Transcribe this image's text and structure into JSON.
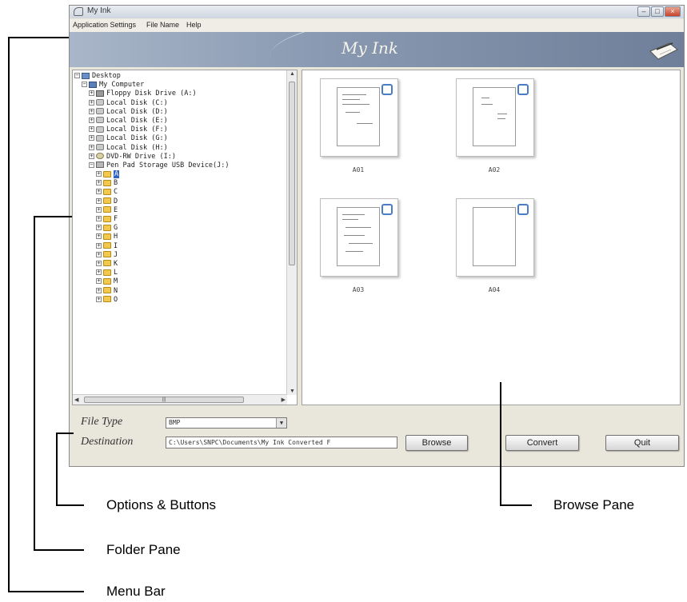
{
  "window": {
    "title": "My Ink",
    "controls": [
      "–",
      "□",
      "×"
    ]
  },
  "menu": {
    "items": [
      "Application Settings",
      "File Name",
      "Help"
    ]
  },
  "banner": {
    "title": "My Ink"
  },
  "tree": [
    {
      "label": "Desktop",
      "icon": "desktop-icon",
      "level": 0,
      "expander": "−"
    },
    {
      "label": "My Computer",
      "icon": "computer-icon",
      "level": 1,
      "expander": "−"
    },
    {
      "label": "Floppy Disk Drive (A:)",
      "icon": "floppy-icon",
      "level": 2,
      "expander": "+"
    },
    {
      "label": "Local Disk (C:)",
      "icon": "drive-icon",
      "level": 2,
      "expander": "+"
    },
    {
      "label": "Local Disk (D:)",
      "icon": "drive-icon",
      "level": 2,
      "expander": "+"
    },
    {
      "label": "Local Disk (E:)",
      "icon": "drive-icon",
      "level": 2,
      "expander": "+"
    },
    {
      "label": "Local Disk (F:)",
      "icon": "drive-icon",
      "level": 2,
      "expander": "+"
    },
    {
      "label": "Local Disk (G:)",
      "icon": "drive-icon",
      "level": 2,
      "expander": "+"
    },
    {
      "label": "Local Disk (H:)",
      "icon": "drive-icon",
      "level": 2,
      "expander": "+"
    },
    {
      "label": "DVD-RW Drive (I:)",
      "icon": "dvd-icon",
      "level": 2,
      "expander": "+"
    },
    {
      "label": "Pen Pad Storage USB Device(J:)",
      "icon": "usb-icon",
      "level": 2,
      "expander": "−"
    },
    {
      "label": "A",
      "icon": "folder-icon",
      "level": 3,
      "expander": "+",
      "selected": true
    },
    {
      "label": "B",
      "icon": "folder-icon",
      "level": 3,
      "expander": "+"
    },
    {
      "label": "C",
      "icon": "folder-icon",
      "level": 3,
      "expander": "+"
    },
    {
      "label": "D",
      "icon": "folder-icon",
      "level": 3,
      "expander": "+"
    },
    {
      "label": "E",
      "icon": "folder-icon",
      "level": 3,
      "expander": "+"
    },
    {
      "label": "F",
      "icon": "folder-icon",
      "level": 3,
      "expander": "+"
    },
    {
      "label": "G",
      "icon": "folder-icon",
      "level": 3,
      "expander": "+"
    },
    {
      "label": "H",
      "icon": "folder-icon",
      "level": 3,
      "expander": "+"
    },
    {
      "label": "I",
      "icon": "folder-icon",
      "level": 3,
      "expander": "+"
    },
    {
      "label": "J",
      "icon": "folder-icon",
      "level": 3,
      "expander": "+"
    },
    {
      "label": "K",
      "icon": "folder-icon",
      "level": 3,
      "expander": "+"
    },
    {
      "label": "L",
      "icon": "folder-icon",
      "level": 3,
      "expander": "+"
    },
    {
      "label": "M",
      "icon": "folder-icon",
      "level": 3,
      "expander": "+"
    },
    {
      "label": "N",
      "icon": "folder-icon",
      "level": 3,
      "expander": "+"
    },
    {
      "label": "O",
      "icon": "folder-icon",
      "level": 3,
      "expander": "+"
    }
  ],
  "thumbnails": [
    {
      "label": "A01"
    },
    {
      "label": "A02"
    },
    {
      "label": "A03"
    },
    {
      "label": "A04"
    }
  ],
  "options": {
    "file_type_label": "File Type",
    "file_type_value": "BMP",
    "destination_label": "Destination",
    "destination_value": "C:\\Users\\SNPC\\Documents\\My Ink Converted F"
  },
  "buttons": {
    "browse": "Browse",
    "convert": "Convert",
    "quit": "Quit"
  },
  "callouts": {
    "options_buttons": "Options & Buttons",
    "browse_pane": "Browse Pane",
    "folder_pane": "Folder Pane",
    "menu_bar": "Menu Bar"
  },
  "colors": {
    "selection": "#3162c5",
    "checkbox": "#4a7cc7"
  }
}
